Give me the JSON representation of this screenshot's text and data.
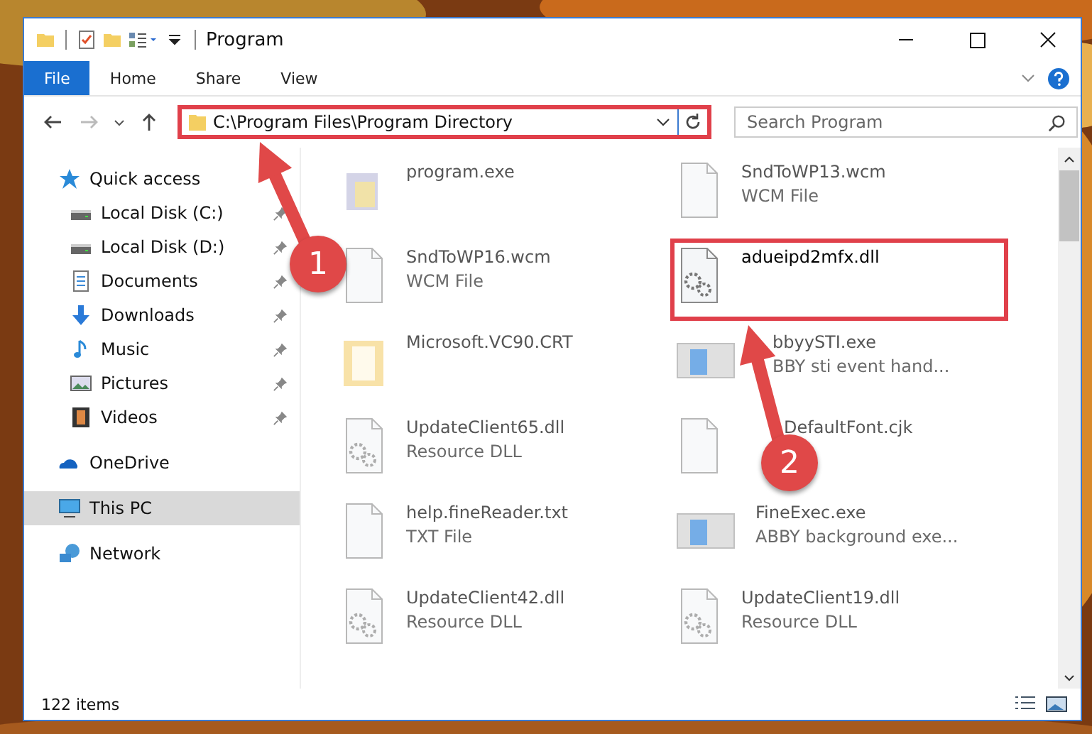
{
  "window": {
    "title": "Program"
  },
  "ribbon": {
    "tabs": [
      {
        "label": "File",
        "selected": true
      },
      {
        "label": "Home",
        "selected": false
      },
      {
        "label": "Share",
        "selected": false
      },
      {
        "label": "View",
        "selected": false
      }
    ]
  },
  "address_bar": {
    "path": "C:\\Program Files\\Program Directory",
    "highlighted": true
  },
  "search": {
    "placeholder": "Search Program"
  },
  "sidebar": {
    "items": [
      {
        "label": "Quick access",
        "kind": "star",
        "selected": false,
        "children": [
          {
            "label": "Local Disk (C:)",
            "kind": "drive",
            "pinned": true
          },
          {
            "label": "Local Disk (D:)",
            "kind": "drive",
            "pinned": true
          },
          {
            "label": "Documents",
            "kind": "documents",
            "pinned": true
          },
          {
            "label": "Downloads",
            "kind": "downloads",
            "pinned": true
          },
          {
            "label": "Music",
            "kind": "music",
            "pinned": true
          },
          {
            "label": "Pictures",
            "kind": "pictures",
            "pinned": true
          },
          {
            "label": "Videos",
            "kind": "videos",
            "pinned": true
          }
        ]
      },
      {
        "label": "OneDrive",
        "kind": "cloud",
        "selected": false
      },
      {
        "label": "This PC",
        "kind": "pc",
        "selected": true
      },
      {
        "label": "Network",
        "kind": "network",
        "selected": false
      }
    ]
  },
  "files": [
    {
      "name": "program.exe",
      "kind": "installer",
      "blurred": true,
      "highlighted": false
    },
    {
      "name": "SndToWP13.wcm",
      "type": "WCM File",
      "kind": "blank",
      "blurred": true,
      "highlighted": false
    },
    {
      "name": "SndToWP16.wcm",
      "type": "WCM File",
      "kind": "blank",
      "blurred": true,
      "highlighted": false
    },
    {
      "name": "adueipd2mfx.dll",
      "kind": "dll",
      "blurred": false,
      "highlighted": true
    },
    {
      "name": "Microsoft.VC90.CRT",
      "kind": "folder",
      "blurred": true,
      "highlighted": false
    },
    {
      "name": "bbyySTI.exe",
      "type": "BBY sti event hand...",
      "kind": "app",
      "blurred": true,
      "highlighted": false
    },
    {
      "name": "UpdateClient65.dll",
      "type": "Resource DLL",
      "kind": "dll",
      "blurred": true,
      "highlighted": false
    },
    {
      "name": "DefaultFont.cjk",
      "kind": "blank",
      "blurred": true,
      "highlighted": false
    },
    {
      "name": "help.fineReader.txt",
      "type": "TXT File",
      "kind": "blank",
      "blurred": true,
      "highlighted": false
    },
    {
      "name": "FineExec.exe",
      "type": "ABBY background exe...",
      "kind": "app",
      "blurred": true,
      "highlighted": false
    },
    {
      "name": "UpdateClient42.dll",
      "type": "Resource DLL",
      "kind": "dll",
      "blurred": true,
      "highlighted": false
    },
    {
      "name": "UpdateClient19.dll",
      "type": "Resource DLL",
      "kind": "dll",
      "blurred": true,
      "highlighted": false
    }
  ],
  "status_bar": {
    "count": "122 items"
  },
  "annotations": [
    {
      "number": "1"
    },
    {
      "number": "2"
    }
  ]
}
